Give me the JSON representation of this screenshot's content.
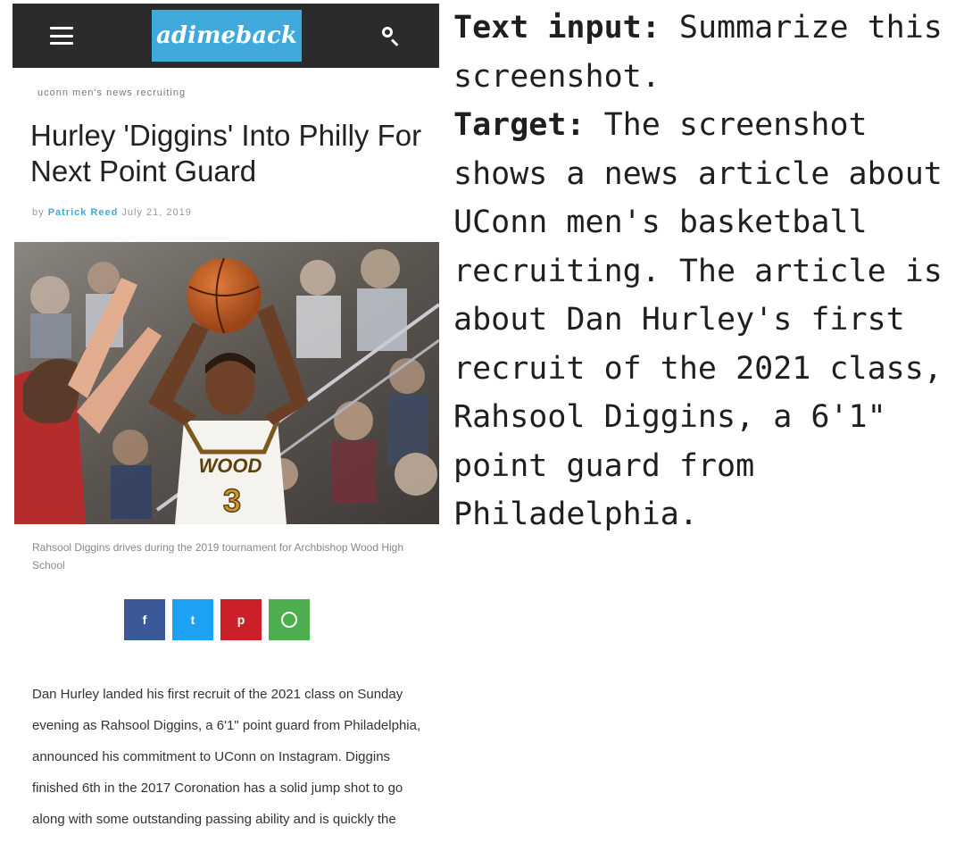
{
  "app": {
    "logo_text": "adimeback",
    "menu_icon": "hamburger-menu-icon",
    "search_icon": "search-icon",
    "header_bg": "#2b2b2b",
    "logo_bg": "#3fa9db"
  },
  "article": {
    "breadcrumb": "uconn men's   news   recruiting",
    "title": "Hurley 'Diggins' Into Philly For Next Point Guard",
    "byline_prefix": "by",
    "byline_author": "Patrick Reed",
    "byline_date": "July 21, 2019",
    "image_caption": "Rahsool Diggins drives during the 2019 tournament for Archbishop Wood High School",
    "share_buttons": [
      {
        "network": "facebook",
        "glyph": "f",
        "color": "#3b5998"
      },
      {
        "network": "twitter",
        "glyph": "t",
        "color": "#1da1f2"
      },
      {
        "network": "pinterest",
        "glyph": "p",
        "color": "#cb2027"
      },
      {
        "network": "whatsapp",
        "glyph": "",
        "color": "#4cae4c"
      }
    ],
    "body": "Dan Hurley landed his first recruit of the 2021 class on Sunday evening as Rahsool Diggins, a 6'1\" point guard from Philadelphia, announced his commitment to UConn on Instagram. Diggins finished 6th in the 2017 Coronation has a solid jump shot to go along with some outstanding passing ability and is quickly the"
  },
  "panel": {
    "input_label": "Text input:",
    "input_text": "Summarize this screenshot.",
    "target_label": "Target:",
    "target_text": "The screenshot shows a news article about UConn men's basketball recruiting. The article is about Dan Hurley's first recruit of the 2021 class, Rahsool Diggins, a 6'1\" point guard from Philadelphia."
  },
  "jersey": {
    "team": "WOOD",
    "number": "3"
  }
}
